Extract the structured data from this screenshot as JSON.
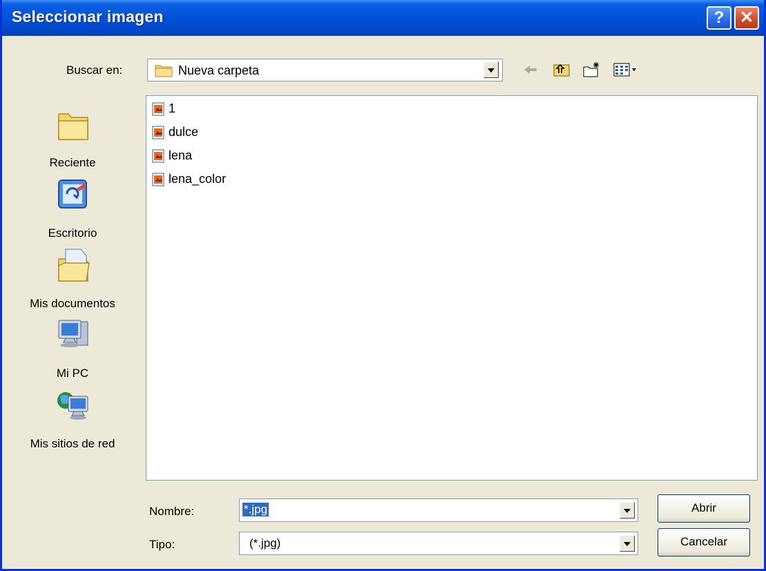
{
  "window": {
    "title": "Seleccionar imagen",
    "help_label": "?",
    "close_label": "✕"
  },
  "lookin": {
    "label": "Buscar en:",
    "value": "Nueva carpeta",
    "icon": "folder-icon"
  },
  "toolbar": {
    "back": "back-arrow-icon",
    "up": "up-folder-icon",
    "new_folder": "new-folder-icon",
    "views": "views-menu-icon"
  },
  "places": [
    {
      "label": "Reciente",
      "icon": "recent-folder-icon"
    },
    {
      "label": "Escritorio",
      "icon": "desktop-icon"
    },
    {
      "label": "Mis documentos",
      "icon": "my-documents-icon"
    },
    {
      "label": "Mi PC",
      "icon": "my-computer-icon"
    },
    {
      "label": "Mis sitios de red",
      "icon": "network-places-icon"
    }
  ],
  "files": [
    {
      "name": "1",
      "icon": "image-file-icon"
    },
    {
      "name": "dulce",
      "icon": "image-file-icon"
    },
    {
      "name": "lena",
      "icon": "image-file-icon"
    },
    {
      "name": "lena_color",
      "icon": "image-file-icon"
    }
  ],
  "filename": {
    "label": "Nombre:",
    "value": "*.jpg"
  },
  "filetype": {
    "label": "Tipo:",
    "value": "(*.jpg)"
  },
  "buttons": {
    "open": "Abrir",
    "cancel": "Cancelar"
  },
  "colors": {
    "title_blue": "#0050d8",
    "selection_blue": "#316ac5",
    "dialog_bg": "#ece9d8"
  }
}
